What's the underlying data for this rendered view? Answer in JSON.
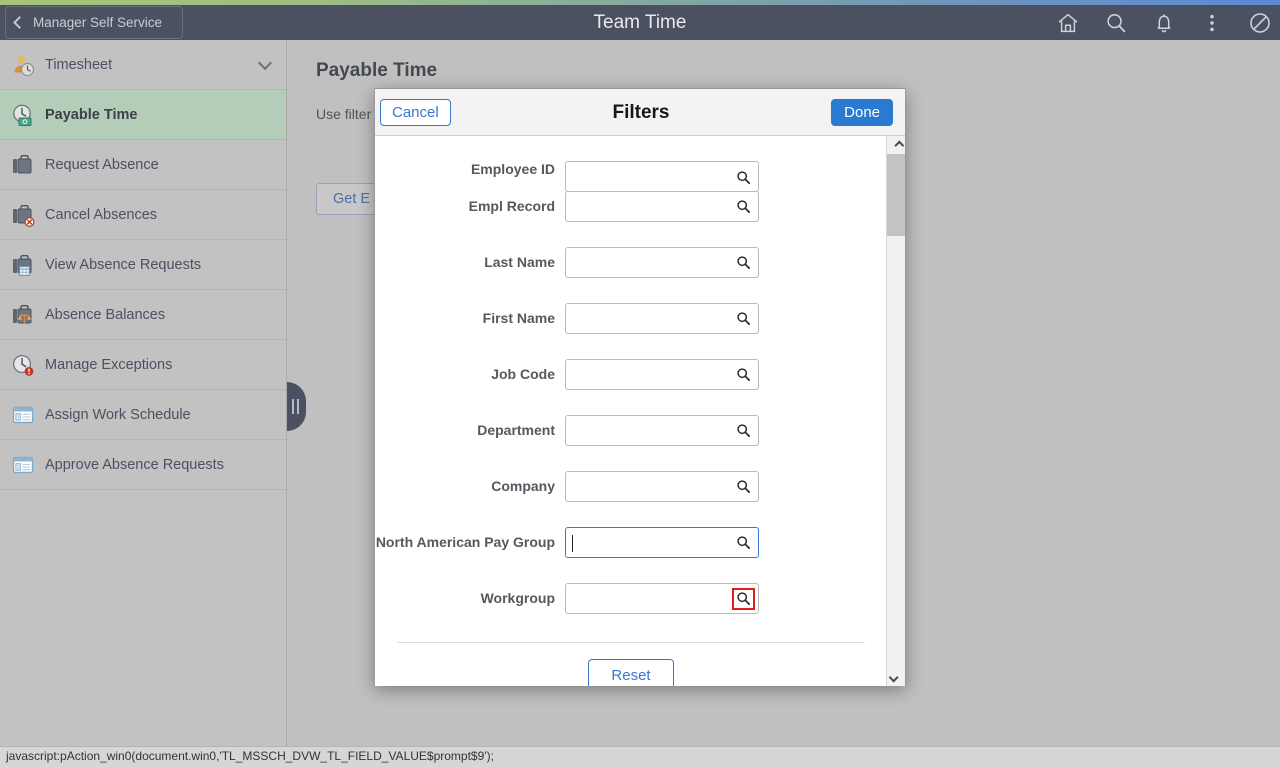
{
  "header": {
    "back_label": "Manager Self Service",
    "title": "Team Time",
    "icons": [
      {
        "name": "home-icon",
        "label": "Home"
      },
      {
        "name": "search-icon",
        "label": "Search"
      },
      {
        "name": "notifications-bell-icon",
        "label": "Notifications"
      },
      {
        "name": "actions-kebab-icon",
        "label": "Actions"
      },
      {
        "name": "navbar-compass-icon",
        "label": "NavBar"
      }
    ]
  },
  "sidebar": {
    "items": [
      {
        "label": "Timesheet",
        "icon": "person-clock-icon",
        "selected": false,
        "expandable": true
      },
      {
        "label": "Payable Time",
        "icon": "clock-money-icon",
        "selected": true,
        "expandable": false
      },
      {
        "label": "Request Absence",
        "icon": "briefcase-icon",
        "selected": false,
        "expandable": false
      },
      {
        "label": "Cancel Absences",
        "icon": "briefcase-cancel-icon",
        "selected": false,
        "expandable": false
      },
      {
        "label": "View Absence Requests",
        "icon": "briefcase-calendar-icon",
        "selected": false,
        "expandable": false
      },
      {
        "label": "Absence Balances",
        "icon": "briefcase-balance-icon",
        "selected": false,
        "expandable": false
      },
      {
        "label": "Manage Exceptions",
        "icon": "clock-alert-icon",
        "selected": false,
        "expandable": false
      },
      {
        "label": "Assign Work Schedule",
        "icon": "window-panel-icon",
        "selected": false,
        "expandable": false
      },
      {
        "label": "Approve Absence Requests",
        "icon": "window-panel-icon",
        "selected": false,
        "expandable": false
      }
    ]
  },
  "main": {
    "page_title": "Payable Time",
    "description": "Use filter            rch Options.",
    "get_button_label": "Get E"
  },
  "modal": {
    "title": "Filters",
    "cancel_label": "Cancel",
    "done_label": "Done",
    "reset_label": "Reset",
    "fields": [
      {
        "label": "Employee ID",
        "value": "",
        "icon": "search-lookup-icon",
        "focused": false,
        "highlighted": false,
        "clipped": true
      },
      {
        "label": "Empl Record",
        "value": "",
        "icon": "search-lookup-icon",
        "focused": false,
        "highlighted": false,
        "clipped": false
      },
      {
        "label": "Last Name",
        "value": "",
        "icon": "search-lookup-icon",
        "focused": false,
        "highlighted": false,
        "clipped": false
      },
      {
        "label": "First Name",
        "value": "",
        "icon": "search-lookup-icon",
        "focused": false,
        "highlighted": false,
        "clipped": false
      },
      {
        "label": "Job Code",
        "value": "",
        "icon": "search-lookup-icon",
        "focused": false,
        "highlighted": false,
        "clipped": false
      },
      {
        "label": "Department",
        "value": "",
        "icon": "search-lookup-icon",
        "focused": false,
        "highlighted": false,
        "clipped": false
      },
      {
        "label": "Company",
        "value": "",
        "icon": "search-lookup-icon",
        "focused": false,
        "highlighted": false,
        "clipped": false
      },
      {
        "label": "North American Pay Group",
        "value": "",
        "icon": "search-lookup-icon",
        "focused": true,
        "highlighted": false,
        "clipped": false
      },
      {
        "label": "Workgroup",
        "value": "",
        "icon": "search-lookup-icon",
        "focused": false,
        "highlighted": true,
        "clipped": false
      }
    ]
  },
  "statusbar": {
    "text": "javascript:pAction_win0(document.win0,'TL_MSSCH_DVW_TL_FIELD_VALUE$prompt$9');"
  },
  "colors": {
    "header_bg": "#4b5160",
    "sidebar_bg": "#c2c2c2",
    "selected_item_bg": "#b4cdb9",
    "accent_blue": "#2a7ad2",
    "link_blue": "#3a76d1",
    "highlight_red": "#e21b1b"
  }
}
